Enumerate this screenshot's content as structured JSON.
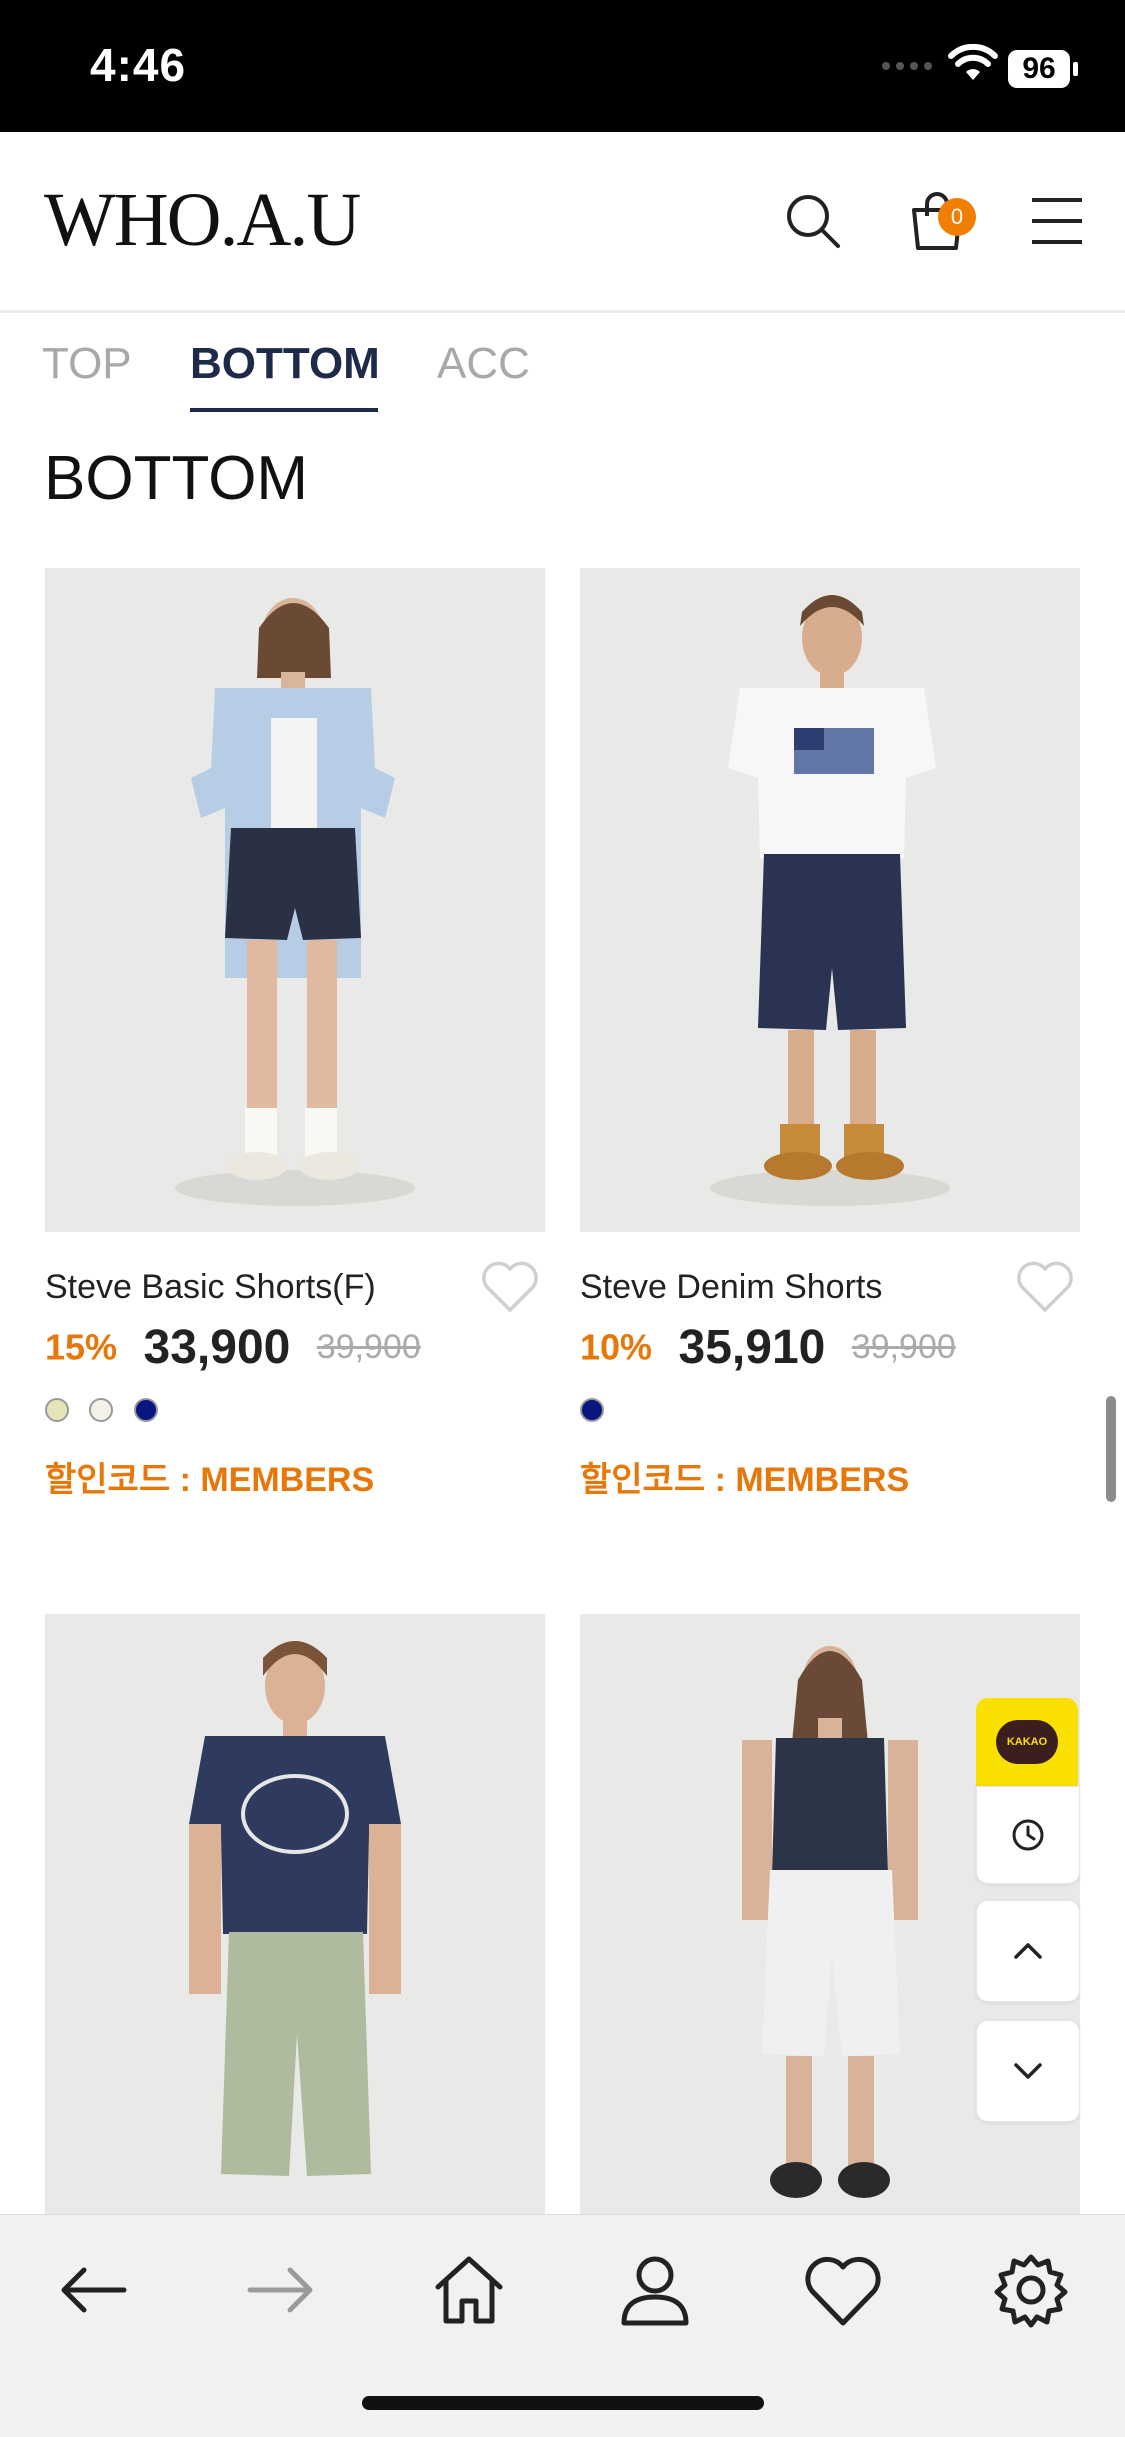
{
  "status_bar": {
    "time": "4:46",
    "battery": "96"
  },
  "header": {
    "logo": "WHO.A.U",
    "cart_count": "0"
  },
  "tabs": [
    {
      "label": "TOP",
      "active": false
    },
    {
      "label": "BOTTOM",
      "active": true
    },
    {
      "label": "ACC",
      "active": false
    }
  ],
  "section_title": "BOTTOM",
  "products": [
    {
      "name": "Steve Basic Shorts(F)",
      "discount": "15%",
      "price": "33,900",
      "original_price": "39,900",
      "colors": [
        "#e6e3b8",
        "#f3f1e8",
        "#0a1680"
      ],
      "promo": "할인코드 : MEMBERS"
    },
    {
      "name": "Steve Denim Shorts",
      "discount": "10%",
      "price": "35,910",
      "original_price": "39,900",
      "colors": [
        "#0a1680"
      ],
      "promo": "할인코드 : MEMBERS"
    },
    {
      "name": "",
      "discount": "",
      "price": "",
      "original_price": "",
      "colors": [],
      "promo": ""
    },
    {
      "name": "",
      "discount": "",
      "price": "",
      "original_price": "",
      "colors": [],
      "promo": ""
    }
  ],
  "floating": {
    "kakao_label": "KAKAO"
  },
  "bottom_nav": [
    "back-arrow-icon",
    "forward-arrow-icon",
    "home-icon",
    "user-icon",
    "heart-icon",
    "gear-icon"
  ],
  "accent_color": "#e8770a",
  "brand_navy": "#1e2a4a"
}
